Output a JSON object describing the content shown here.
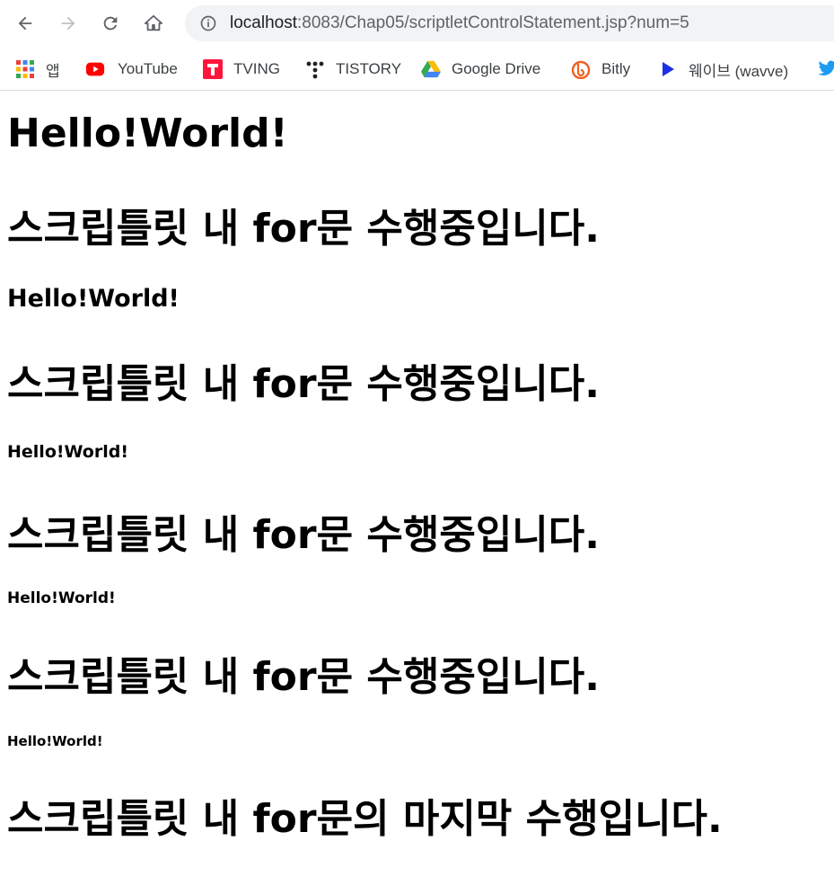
{
  "browser": {
    "url_host": "localhost",
    "url_rest": ":8083/Chap05/scriptletControlStatement.jsp?num=5"
  },
  "bookmarks": [
    {
      "label": "앱",
      "icon": "apps-grid-icon"
    },
    {
      "label": "YouTube",
      "icon": "youtube-icon"
    },
    {
      "label": "TVING",
      "icon": "tving-icon"
    },
    {
      "label": "TISTORY",
      "icon": "tistory-icon"
    },
    {
      "label": "Google Drive",
      "icon": "google-drive-icon"
    },
    {
      "label": "Bitly",
      "icon": "bitly-icon"
    },
    {
      "label": "웨이브 (wavve)",
      "icon": "wavve-icon"
    }
  ],
  "lines": [
    {
      "hello": "Hello!World!",
      "msg": "스크립틀릿 내 for문 수행중입니다."
    },
    {
      "hello": "Hello!World!",
      "msg": "스크립틀릿 내 for문 수행중입니다."
    },
    {
      "hello": "Hello!World!",
      "msg": "스크립틀릿 내 for문 수행중입니다."
    },
    {
      "hello": "Hello!World!",
      "msg": "스크립틀릿 내 for문 수행중입니다."
    },
    {
      "hello": "Hello!World!",
      "msg": "스크립틀릿 내 for문의 마지막 수행입니다."
    }
  ],
  "colors": {
    "youtube": "#ff0000",
    "tving": "#ff153c",
    "wavve": "#1c2fe8",
    "twitter": "#1d9bf0"
  }
}
